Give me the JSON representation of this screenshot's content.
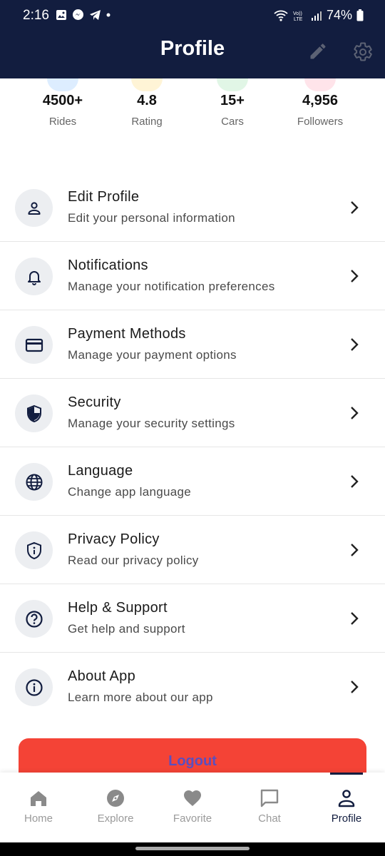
{
  "status": {
    "time": "2:16",
    "battery": "74%"
  },
  "header": {
    "title": "Profile"
  },
  "stats": [
    {
      "value": "4500+",
      "label": "Rides"
    },
    {
      "value": "4.8",
      "label": "Rating"
    },
    {
      "value": "15+",
      "label": "Cars"
    },
    {
      "value": "4,956",
      "label": "Followers"
    }
  ],
  "menu": [
    {
      "title": "Edit Profile",
      "subtitle": "Edit your personal information",
      "icon": "person-icon"
    },
    {
      "title": "Notifications",
      "subtitle": "Manage your notification preferences",
      "icon": "bell-icon"
    },
    {
      "title": "Payment Methods",
      "subtitle": "Manage your payment options",
      "icon": "credit-card-icon"
    },
    {
      "title": "Security",
      "subtitle": "Manage your security settings",
      "icon": "shield-icon"
    },
    {
      "title": "Language",
      "subtitle": "Change app language",
      "icon": "globe-icon"
    },
    {
      "title": "Privacy Policy",
      "subtitle": "Read our privacy policy",
      "icon": "privacy-shield-icon"
    },
    {
      "title": "Help & Support",
      "subtitle": "Get help and support",
      "icon": "help-icon"
    },
    {
      "title": "About App",
      "subtitle": "Learn more about our app",
      "icon": "info-icon"
    }
  ],
  "logout": {
    "label": "Logout"
  },
  "bottom_nav": [
    {
      "label": "Home",
      "icon": "home-icon",
      "active": false
    },
    {
      "label": "Explore",
      "icon": "compass-icon",
      "active": false
    },
    {
      "label": "Favorite",
      "icon": "heart-icon",
      "active": false
    },
    {
      "label": "Chat",
      "icon": "chat-icon",
      "active": false
    },
    {
      "label": "Profile",
      "icon": "person-icon",
      "active": true
    }
  ],
  "colors": {
    "header_bg": "#121d3f",
    "logout_bg": "#f44336",
    "logout_text": "#5a4fc0",
    "nav_inactive": "#9a9a9a",
    "nav_active": "#121d3f"
  }
}
